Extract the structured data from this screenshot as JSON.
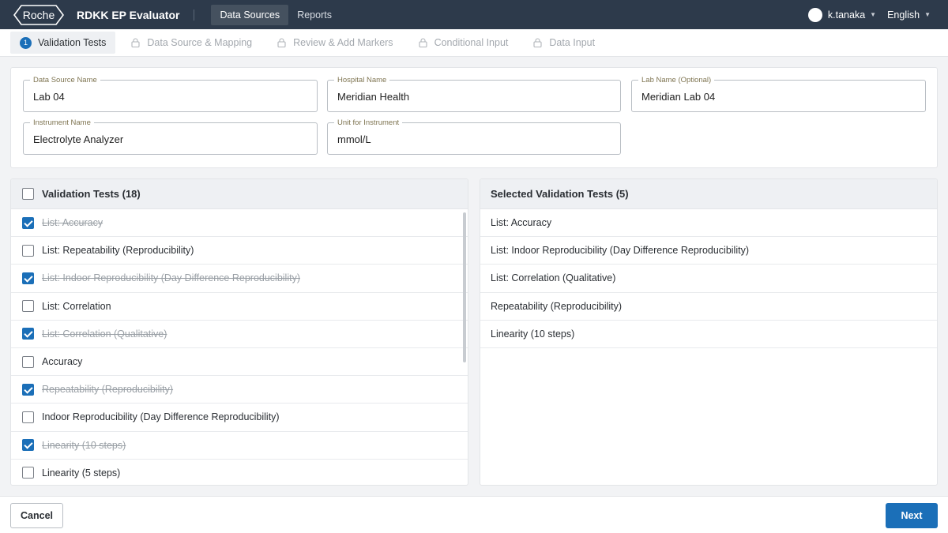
{
  "header": {
    "logo_text": "Roche",
    "app_title": "RDKK EP Evaluator",
    "nav": [
      {
        "label": "Data Sources"
      },
      {
        "label": "Reports"
      }
    ],
    "user_name": "k.tanaka",
    "language": "English"
  },
  "steps": [
    {
      "number": "1",
      "label": "Validation Tests"
    },
    {
      "label": "Data Source & Mapping"
    },
    {
      "label": "Review & Add Markers"
    },
    {
      "label": "Conditional Input"
    },
    {
      "label": "Data Input"
    }
  ],
  "form": {
    "data_source_name": {
      "label": "Data Source Name",
      "value": "Lab 04"
    },
    "hospital_name": {
      "label": "Hospital Name",
      "value": "Meridian Health"
    },
    "lab_name": {
      "label": "Lab Name (Optional)",
      "value": "Meridian Lab 04"
    },
    "instrument_name": {
      "label": "Instrument Name",
      "value": "Electrolyte Analyzer"
    },
    "unit": {
      "label": "Unit for Instrument",
      "value": "mmol/L"
    }
  },
  "validation_tests": {
    "title": "Validation Tests (18)",
    "items": [
      {
        "label": "List: Accuracy",
        "checked": true
      },
      {
        "label": "List: Repeatability (Reproducibility)",
        "checked": false
      },
      {
        "label": "List: Indoor Reproducibility (Day Difference Reproducibility)",
        "checked": true
      },
      {
        "label": "List: Correlation",
        "checked": false
      },
      {
        "label": "List: Correlation (Qualitative)",
        "checked": true
      },
      {
        "label": "Accuracy",
        "checked": false
      },
      {
        "label": "Repeatability (Reproducibility)",
        "checked": true
      },
      {
        "label": "Indoor Reproducibility (Day Difference Reproducibility)",
        "checked": false
      },
      {
        "label": "Linearity (10 steps)",
        "checked": true
      },
      {
        "label": "Linearity (5 steps)",
        "checked": false
      }
    ]
  },
  "selected_tests": {
    "title": "Selected Validation Tests (5)",
    "items": [
      {
        "label": "List: Accuracy"
      },
      {
        "label": "List: Indoor Reproducibility (Day Difference Reproducibility)"
      },
      {
        "label": "List: Correlation (Qualitative)"
      },
      {
        "label": "Repeatability (Reproducibility)"
      },
      {
        "label": "Linearity (10 steps)"
      }
    ]
  },
  "footer": {
    "cancel_label": "Cancel",
    "next_label": "Next"
  },
  "colors": {
    "topbar": "#2d3a4b",
    "accent": "#1b6fb8"
  }
}
